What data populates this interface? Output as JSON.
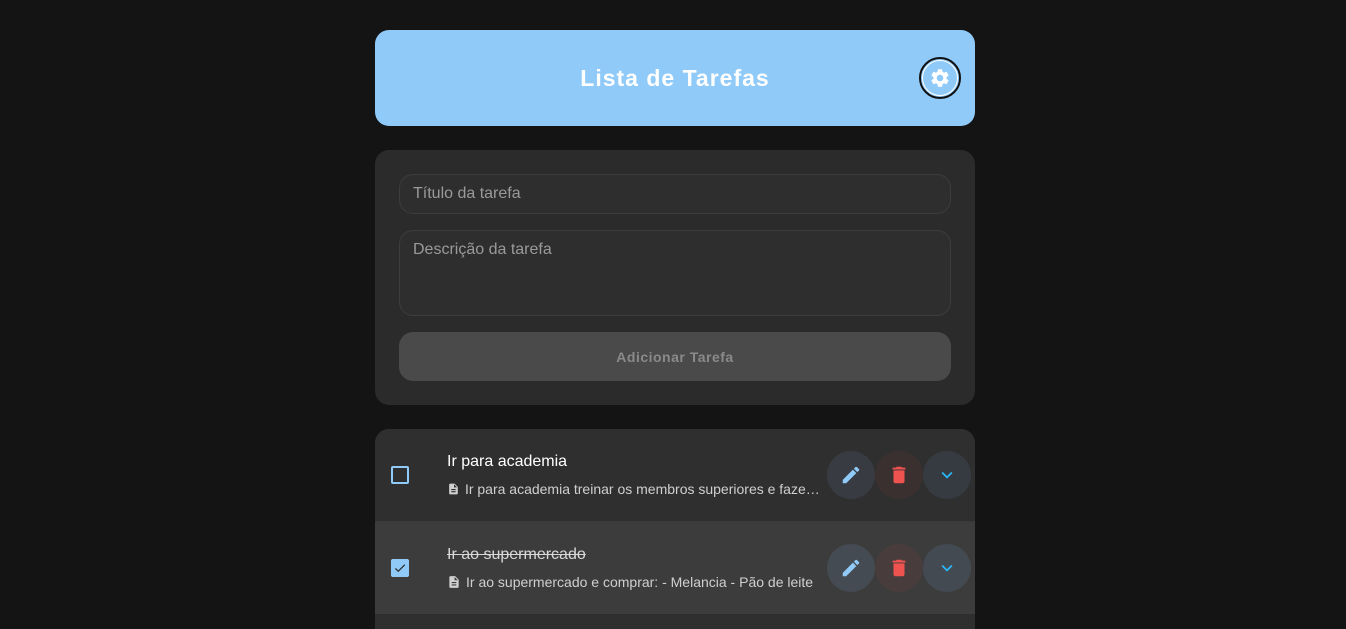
{
  "header": {
    "title": "Lista de Tarefas",
    "settings_icon": "gear-icon"
  },
  "form": {
    "title_placeholder": "Título da tarefa",
    "description_placeholder": "Descrição da tarefa",
    "add_button_label": "Adicionar Tarefa"
  },
  "tasks": [
    {
      "title": "Ir para academia",
      "description": "Ir para academia treinar os membros superiores e fazer cardio",
      "completed": false
    },
    {
      "title": "Ir ao supermercado",
      "description": "Ir ao supermercado e comprar: - Melancia - Pão de leite",
      "completed": true
    }
  ],
  "colors": {
    "accent": "#90caf9",
    "background": "#141414",
    "card": "#2b2b2b",
    "delete": "#ef5350",
    "expand": "#29b6f6"
  }
}
